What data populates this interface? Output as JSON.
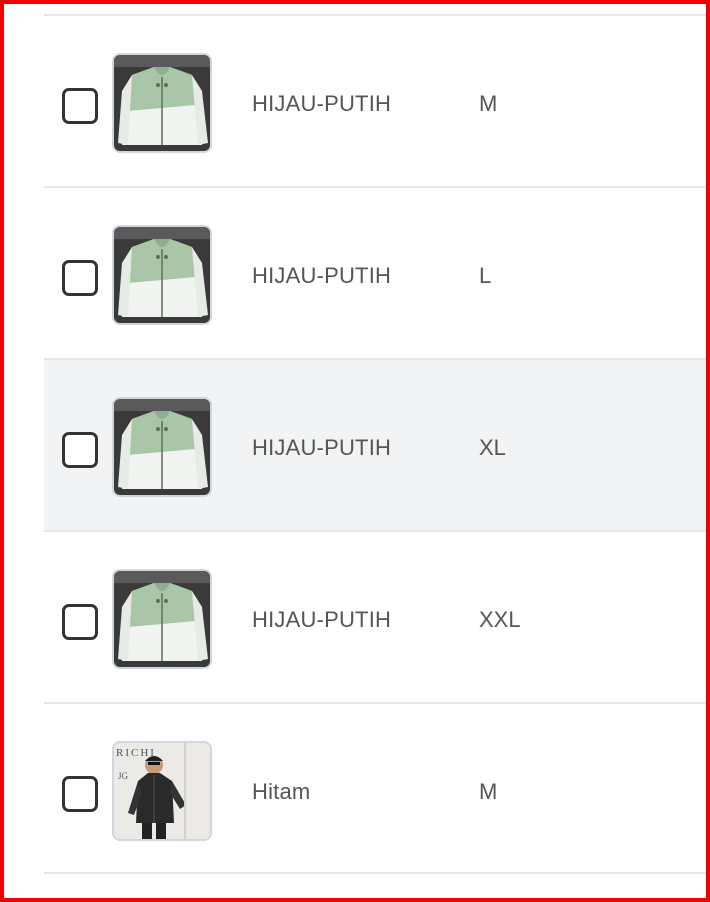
{
  "variants": [
    {
      "color": "HIJAU-PUTIH",
      "size": "M",
      "image": "green-white-jacket-image",
      "checked": false
    },
    {
      "color": "HIJAU-PUTIH",
      "size": "L",
      "image": "green-white-jacket-image",
      "checked": false
    },
    {
      "color": "HIJAU-PUTIH",
      "size": "XL",
      "image": "green-white-jacket-image",
      "checked": false
    },
    {
      "color": "HIJAU-PUTIH",
      "size": "XXL",
      "image": "green-white-jacket-image",
      "checked": false
    },
    {
      "color": "Hitam",
      "size": "M",
      "image": "black-jacket-model-image",
      "checked": false
    }
  ],
  "thumbnail_texts": {
    "black_jacket": [
      "RICHI",
      "JG"
    ]
  },
  "colors": {
    "frame_border": "#f00000",
    "row_divider": "#e4e7ec",
    "row_highlight": "#f1f3f5",
    "text": "#555555",
    "checkbox_border": "#333333",
    "jacket_green": "#a9c7a8"
  }
}
